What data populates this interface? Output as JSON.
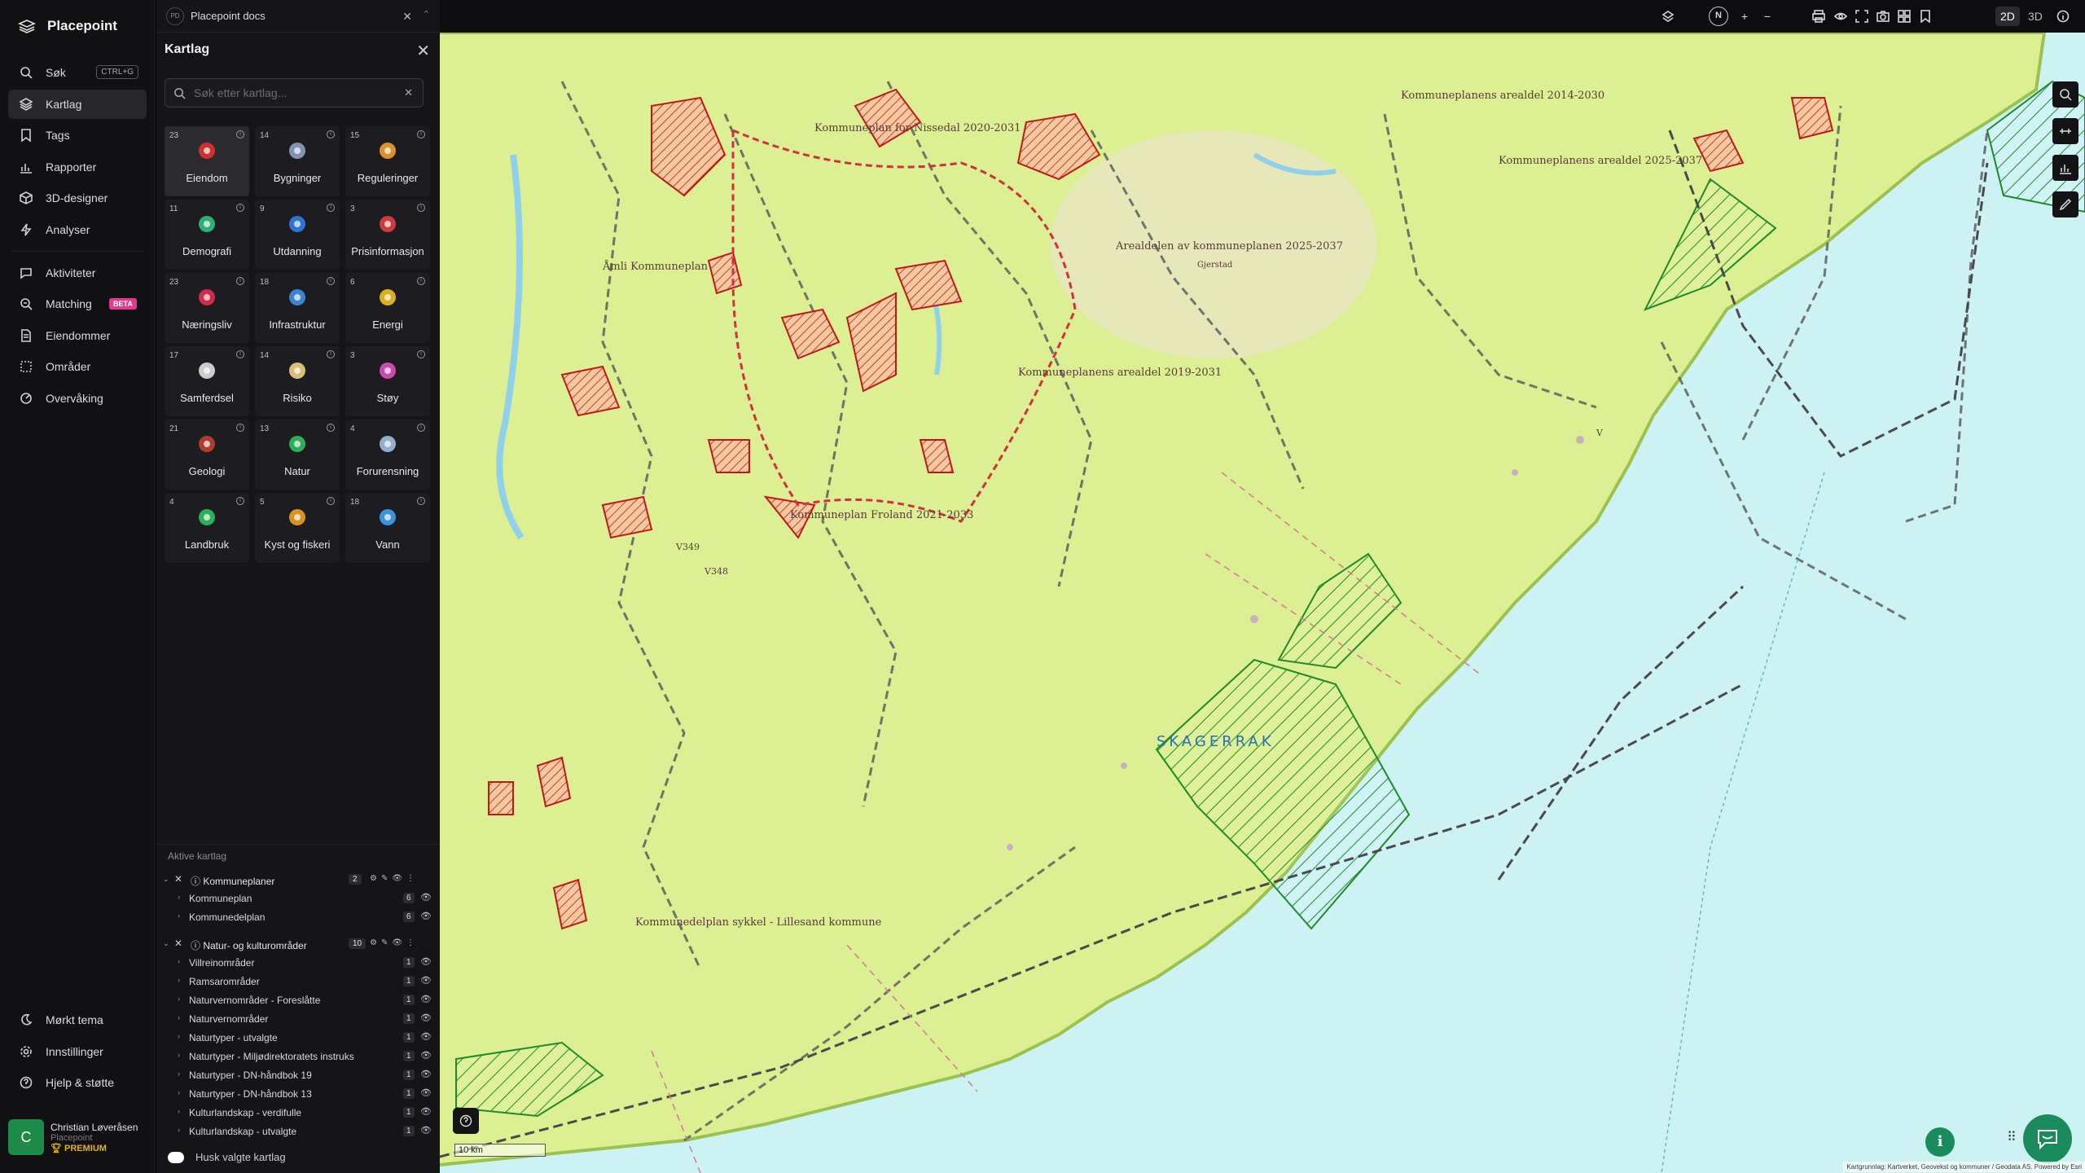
{
  "app": {
    "name": "Placepoint"
  },
  "nav": {
    "items": [
      {
        "label": "Søk",
        "kbd": "CTRL+G"
      },
      {
        "label": "Kartlag"
      },
      {
        "label": "Tags"
      },
      {
        "label": "Rapporter"
      },
      {
        "label": "3D-designer"
      },
      {
        "label": "Analyser"
      },
      {
        "label": "Aktiviteter"
      },
      {
        "label": "Matching",
        "badge": "BETA"
      },
      {
        "label": "Eiendommer"
      },
      {
        "label": "Områder"
      },
      {
        "label": "Overvåking"
      }
    ],
    "bottom": [
      {
        "label": "Mørkt tema"
      },
      {
        "label": "Innstillinger"
      },
      {
        "label": "Hjelp & støtte"
      }
    ],
    "user": {
      "initial": "C",
      "name": "Christian Løveråsen",
      "org": "Placepoint",
      "plan": "PREMIUM"
    }
  },
  "panel": {
    "doc_icon": "PD",
    "doc_title": "Placepoint docs",
    "title": "Kartlag",
    "search_placeholder": "Søk etter kartlag...",
    "categories": [
      {
        "count": "23",
        "label": "Eiendom",
        "icon": "pin-icon",
        "color": "#e03030"
      },
      {
        "count": "14",
        "label": "Bygninger",
        "icon": "building-icon",
        "color": "#8ea0c0"
      },
      {
        "count": "15",
        "label": "Reguleringer",
        "icon": "signpost-icon",
        "color": "#f0a030"
      },
      {
        "count": "11",
        "label": "Demografi",
        "icon": "demography-icon",
        "color": "#30c080"
      },
      {
        "count": "9",
        "label": "Utdanning",
        "icon": "graduation-icon",
        "color": "#3080e0"
      },
      {
        "count": "3",
        "label": "Prisinformasjon",
        "icon": "price-bag-icon",
        "color": "#e04040"
      },
      {
        "count": "23",
        "label": "Næringsliv",
        "icon": "business-bag-icon",
        "color": "#e03050"
      },
      {
        "count": "18",
        "label": "Infrastruktur",
        "icon": "globe-icon",
        "color": "#4090e0"
      },
      {
        "count": "6",
        "label": "Energi",
        "icon": "lightning-icon",
        "color": "#f0c020"
      },
      {
        "count": "17",
        "label": "Samferdsel",
        "icon": "bus-icon",
        "color": "#e0e0e0"
      },
      {
        "count": "14",
        "label": "Risiko",
        "icon": "risk-icon",
        "color": "#f0d080"
      },
      {
        "count": "3",
        "label": "Støy",
        "icon": "noise-icon",
        "color": "#e050c0"
      },
      {
        "count": "21",
        "label": "Geologi",
        "icon": "geology-icon",
        "color": "#c04030"
      },
      {
        "count": "13",
        "label": "Natur",
        "icon": "leaf-icon",
        "color": "#30c060"
      },
      {
        "count": "4",
        "label": "Forurensning",
        "icon": "factory-icon",
        "color": "#a0c0e0"
      },
      {
        "count": "4",
        "label": "Landbruk",
        "icon": "sprout-icon",
        "color": "#30c060"
      },
      {
        "count": "5",
        "label": "Kyst og fiskeri",
        "icon": "fish-icon",
        "color": "#f0a020"
      },
      {
        "count": "18",
        "label": "Vann",
        "icon": "water-drop-icon",
        "color": "#40a0f0"
      }
    ],
    "active_title": "Aktive kartlag",
    "groups": [
      {
        "label": "Kommuneplaner",
        "count": "2",
        "subs": [
          {
            "label": "Kommuneplan",
            "count": "6"
          },
          {
            "label": "Kommunedelplan",
            "count": "6"
          }
        ]
      },
      {
        "label": "Natur- og kulturområder",
        "count": "10",
        "subs": [
          {
            "label": "Villreinområder",
            "count": "1"
          },
          {
            "label": "Ramsarområder",
            "count": "1"
          },
          {
            "label": "Naturvernområder - Foreslåtte",
            "count": "1"
          },
          {
            "label": "Naturvernområder",
            "count": "1"
          },
          {
            "label": "Naturtyper - utvalgte",
            "count": "1"
          },
          {
            "label": "Naturtyper - Miljødirektoratets instruks",
            "count": "1"
          },
          {
            "label": "Naturtyper - DN-håndbok 19",
            "count": "1"
          },
          {
            "label": "Naturtyper - DN-håndbok 13",
            "count": "1"
          },
          {
            "label": "Kulturlandskap - verdifulle",
            "count": "1"
          },
          {
            "label": "Kulturlandskap - utvalgte",
            "count": "1"
          }
        ]
      }
    ],
    "remember_label": "Husk valgte kartlag"
  },
  "topbar": {
    "compass": "N",
    "mode_2d": "2D",
    "mode_3d": "3D"
  },
  "map": {
    "sea_label": "SKAGERRAK",
    "labels": [
      "Kommuneplanens arealdel 2025-2037",
      "Kommuneplan for Nissedal 2020-2031",
      "Åmli Kommuneplan",
      "Kommuneplanens arealdel 2019-2031",
      "Kommuneplan Froland 2021-2033",
      "Arealdelen av kommuneplanen 2025-2037",
      "Kommuneplanens arealdel 2014-2030",
      "Kommunedelplan sykkel - Lillesand kommune",
      "Gjerstad",
      "V349",
      "V348",
      "V"
    ],
    "scale": "10 km",
    "attribution": "Kartgrunnlag: Kartverket, Geovekst og kommuner / Geodata AS. Powered by Esri"
  }
}
